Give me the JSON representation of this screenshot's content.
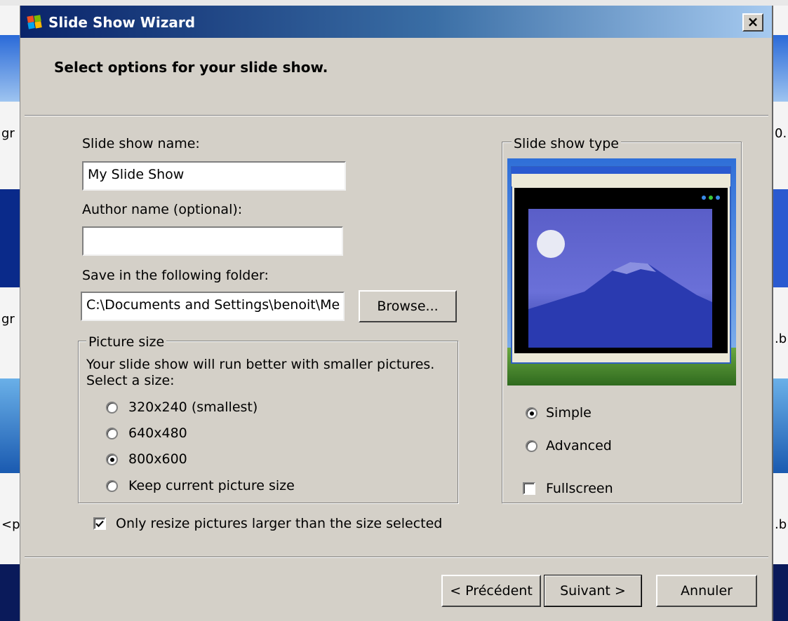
{
  "dialog": {
    "title": "Slide Show Wizard",
    "close_label": "×",
    "header": "Select options for your slide show."
  },
  "form": {
    "name_label": "Slide show name:",
    "name_value": "My Slide Show",
    "author_label": "Author name (optional):",
    "author_value": "",
    "folder_label": "Save in the following folder:",
    "folder_value": "C:\\Documents and Settings\\benoit\\Me",
    "browse_label": "Browse..."
  },
  "picture_size": {
    "title": "Picture size",
    "description": "Your slide show will run better with smaller pictures.",
    "select_prompt": "Select a size:",
    "options": [
      {
        "label": "320x240 (smallest)",
        "selected": false
      },
      {
        "label": "640x480",
        "selected": false
      },
      {
        "label": "800x600",
        "selected": true
      },
      {
        "label": "Keep current picture size",
        "selected": false
      }
    ]
  },
  "resize_option": {
    "label": "Only resize pictures larger than the size selected",
    "checked": true
  },
  "slide_show_type": {
    "title": "Slide show type",
    "options": [
      {
        "label": "Simple",
        "selected": true
      },
      {
        "label": "Advanced",
        "selected": false
      }
    ],
    "fullscreen_label": "Fullscreen",
    "fullscreen_checked": false
  },
  "footer": {
    "back_label": "< Précédent",
    "next_label": "Suivant >",
    "cancel_label": "Annuler"
  },
  "background": {
    "fragments": [
      "gr",
      "gr",
      "0.",
      ".b",
      "<p",
      ".b"
    ]
  },
  "colors": {
    "dialog_face": "#d4d0c8",
    "title_start": "#0a246a",
    "title_end": "#a6caf0"
  }
}
